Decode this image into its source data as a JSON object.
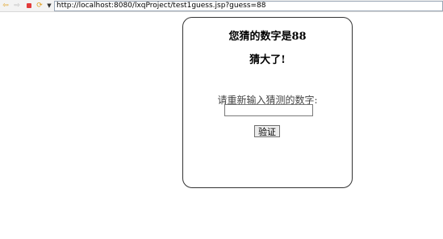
{
  "browser": {
    "url": "http://localhost:8080/lxqProject/test1guess.jsp?guess=88",
    "icons": [
      "back-arrow-icon",
      "forward-arrow-icon",
      "stop-icon",
      "refresh-icon",
      "menu-dropdown-icon"
    ]
  },
  "page": {
    "title_prefix": "您猜的数字是",
    "guess": "88",
    "hint": "猜大了!",
    "prompt": "请重新输入猜测的数字:",
    "input_value": "",
    "submit_label": "验证"
  }
}
